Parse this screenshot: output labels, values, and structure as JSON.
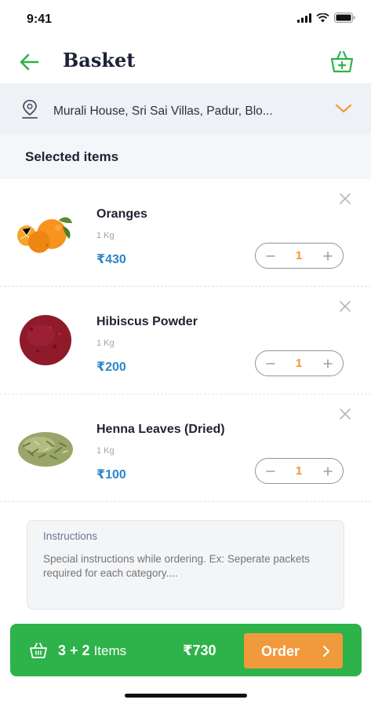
{
  "status": {
    "time": "9:41"
  },
  "header": {
    "title": "Basket"
  },
  "address": {
    "text": "Murali House, Sri Sai Villas, Padur, Blo..."
  },
  "section": {
    "title": "Selected items"
  },
  "items": [
    {
      "name": "Oranges",
      "weight": "1 Kg",
      "price": "₹430",
      "qty": "1",
      "image": "oranges"
    },
    {
      "name": "Hibiscus Powder",
      "weight": "1 Kg",
      "price": "₹200",
      "qty": "1",
      "image": "hibiscus-powder"
    },
    {
      "name": "Henna Leaves (Dried)",
      "weight": "1 Kg",
      "price": "₹100",
      "qty": "1",
      "image": "henna-leaves"
    }
  ],
  "instructions": {
    "label": "Instructions",
    "placeholder": "Special instructions while ordering. Ex: Seperate packets required for each category...."
  },
  "order_bar": {
    "count": "3 + 2",
    "count_suffix": "Items",
    "total": "₹730",
    "button_label": "Order"
  },
  "colors": {
    "accent_green": "#2db349",
    "accent_orange": "#f09a3c",
    "price_blue": "#2e86c9"
  }
}
